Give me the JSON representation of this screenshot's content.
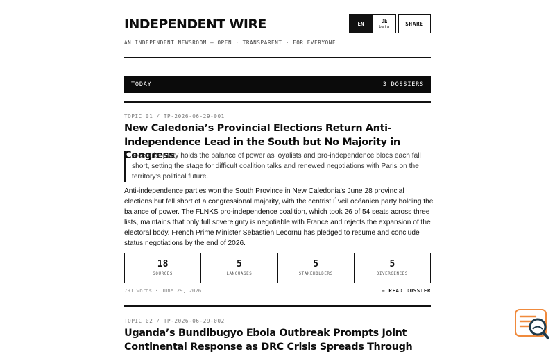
{
  "header": {
    "masthead": "INDEPENDENT WIRE",
    "tagline": "AN INDEPENDENT NEWSROOM — OPEN · TRANSPARENT · FOR EVERYONE",
    "lang_en": "EN",
    "lang_de": "DE",
    "lang_de_badge": "beta",
    "share_label": "SHARE"
  },
  "today_bar": {
    "label": "TODAY",
    "count": "3 DOSSIERS"
  },
  "dossiers": [
    {
      "meta": "TOPIC 01 / TP-2026-06-29-001",
      "headline": "New Caledonia’s Provincial Elections Return Anti-Independence Lead in the South but No Majority in Congress",
      "lede": "A centrist party holds the balance of power as loyalists and pro-independence blocs each fall short, setting the stage for difficult coalition talks and renewed negotiations with Paris on the territory’s political future.",
      "body": "Anti-independence parties won the South Province in New Caledonia’s June 28 provincial elections but fell short of a congressional majority, with the centrist Éveil océanien party holding the balance of power. The FLNKS pro-independence coalition, which took 26 of 54 seats across three lists, maintains that only full sovereignty is negotiable with France and rejects the expansion of the electoral body. French Prime Minister Sebastien Lecornu has pledged to resume and conclude status negotiations by the end of 2026.",
      "stats": [
        {
          "value": "18",
          "label": "SOURCES"
        },
        {
          "value": "5",
          "label": "LANGUAGES"
        },
        {
          "value": "5",
          "label": "STAKEHOLDERS"
        },
        {
          "value": "5",
          "label": "DIVERGENCES"
        }
      ],
      "footer": "791 words · June 29, 2026",
      "read_label": "→ READ DOSSIER"
    },
    {
      "meta": "TOPIC 02 / TP-2026-06-29-002",
      "headline": "Uganda’s Bundibugyo Ebola Outbreak Prompts Joint Continental Response as DRC Crisis Spreads Through"
    }
  ],
  "colors": {
    "ink": "#111111",
    "fab_accent": "#f08a3c",
    "fab_dark": "#1f3a4a"
  },
  "icons": {
    "fab": "document-search-icon"
  }
}
